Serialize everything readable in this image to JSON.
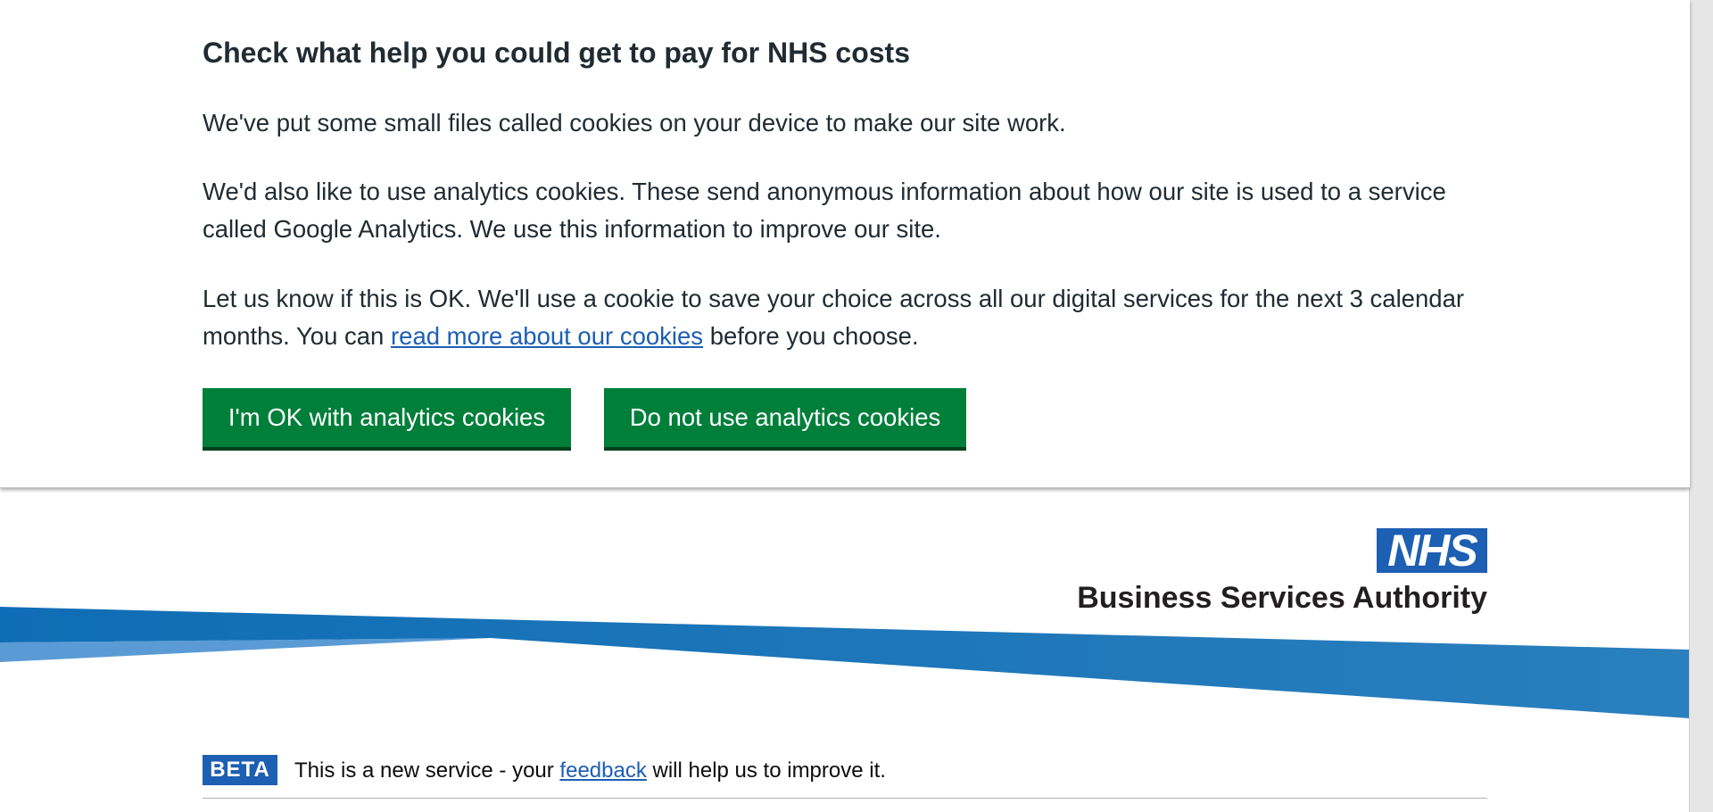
{
  "cookie_banner": {
    "title": "Check what help you could get to pay for NHS costs",
    "paragraph_1": "We've put some small files called cookies on your device to make our site work.",
    "paragraph_2": "We'd also like to use analytics cookies. These send anonymous information about how our site is used to a service called Google Analytics. We use this information to improve our site.",
    "paragraph_3_before": "Let us know if this is OK. We'll use a cookie to save your choice across all our digital services for the next 3 calendar months. You can ",
    "paragraph_3_link": "read more about our cookies",
    "paragraph_3_after": " before you choose.",
    "accept_label": "I'm OK with analytics cookies",
    "reject_label": "Do not use analytics cookies"
  },
  "header": {
    "logo_mark": "NHS",
    "logo_text": "Business Services Authority"
  },
  "beta_banner": {
    "tag": "BETA",
    "text_before": "This is a new service - your ",
    "link": "feedback",
    "text_after": " will help us to improve it."
  },
  "colors": {
    "nhs_blue": "#1d5fb3",
    "button_green": "#007f3b",
    "text": "#212b32"
  }
}
